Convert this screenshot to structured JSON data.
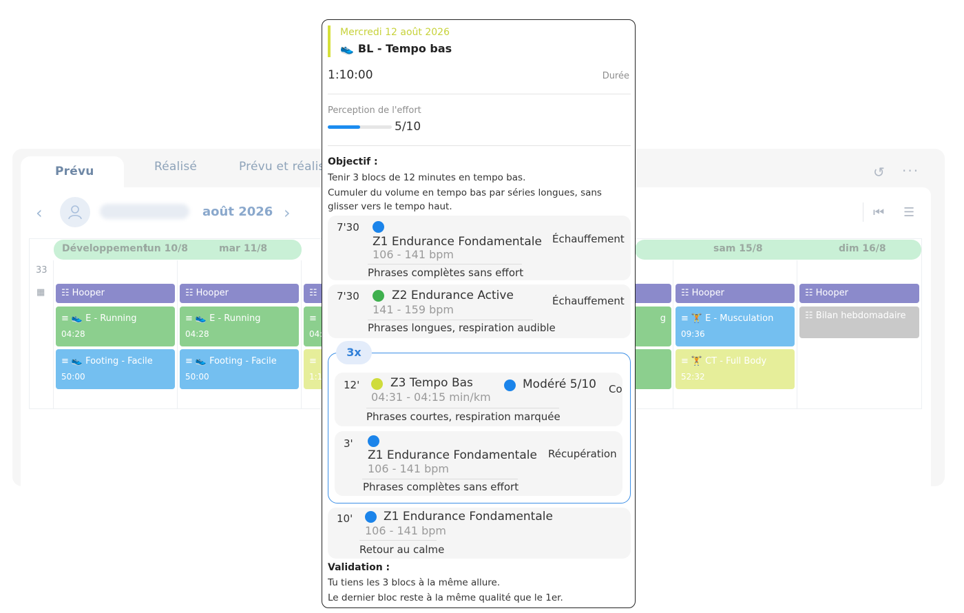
{
  "tabs": {
    "planned": "Prévu",
    "done": "Réalisé",
    "both": "Prévu et réalisé"
  },
  "calendar": {
    "month": "août 2026",
    "week_number": "33",
    "phase": "Développement",
    "days": [
      "lun 10/8",
      "mar 11/8",
      "sam 15/8",
      "dim 16/8"
    ],
    "cards": {
      "hooper": "Hooper",
      "e_running": "E - Running",
      "e_running_dur": "04:28",
      "footing": "Footing - Facile",
      "footing_dur": "50:00",
      "partial_1": "04:",
      "partial_2": "1:1",
      "partial_g": "g",
      "e_musculation": "E - Musculation",
      "e_musculation_dur": "09:36",
      "ct_full_body": "CT - Full Body",
      "ct_full_body_dur": "52:32",
      "bilan": "Bilan hebdomadaire"
    }
  },
  "modal": {
    "date": "Mercredi 12 août 2026",
    "title": "BL - Tempo bas",
    "duration": "1:10:00",
    "duration_label": "Durée",
    "perception_label": "Perception de l'effort",
    "perception_value": "5/10",
    "perception_fraction": 0.5,
    "objective_heading": "Objectif :",
    "objective_line1": "Tenir 3 blocs de 12 minutes en tempo bas.",
    "objective_line2": "Cumuler du volume en tempo bas par séries longues, sans glisser vers le tempo haut.",
    "loop_count": "3x",
    "steps": [
      {
        "minutes": "7'30",
        "zone": "Z1 Endurance Fondamentale",
        "range": "106 - 141 bpm",
        "type": "Échauffement",
        "note": "Phrases complètes sans effort",
        "color": "#1b84ea"
      },
      {
        "minutes": "7'30",
        "zone": "Z2 Endurance Active",
        "range": "141 - 159 bpm",
        "type": "Échauffement",
        "note": "Phrases longues, respiration audible",
        "color": "#3fb04e"
      },
      {
        "minutes": "12'",
        "zone": "Z3 Tempo Bas",
        "range": "04:31 - 04:15 min/km",
        "intensity": "Modéré 5/10",
        "type": "Co",
        "note": "Phrases courtes, respiration marquée",
        "color": "#cfdc3c"
      },
      {
        "minutes": "3'",
        "zone": "Z1 Endurance Fondamentale",
        "range": "106 - 141 bpm",
        "type": "Récupération",
        "note": "Phrases complètes sans effort",
        "color": "#1b84ea"
      },
      {
        "minutes": "10'",
        "zone": "Z1 Endurance Fondamentale",
        "range": "106 - 141 bpm",
        "type": "",
        "note": "Retour au calme",
        "color": "#1b84ea"
      }
    ],
    "validation_heading": "Validation :",
    "validation_line1": "Tu tiens les 3 blocs à la même allure.",
    "validation_line2": "Le dernier bloc reste à la même qualité que le 1er."
  }
}
